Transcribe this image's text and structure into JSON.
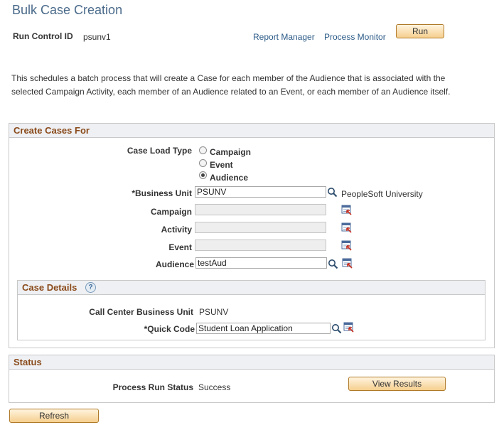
{
  "page": {
    "title": "Bulk Case Creation",
    "run_control_label": "Run Control ID",
    "run_control_value": "psunv1",
    "report_manager": "Report Manager",
    "process_monitor": "Process Monitor",
    "run_button": "Run",
    "description": "This schedules a batch process that will create a Case for each member of the Audience that is associated with the selected Campaign Activity, each member of an Audience related to an Event, or each member of an Audience itself."
  },
  "create_cases": {
    "header": "Create Cases For",
    "case_load_type_label": "Case Load Type",
    "options": [
      {
        "label": "Campaign",
        "selected": false
      },
      {
        "label": "Event",
        "selected": false
      },
      {
        "label": "Audience",
        "selected": true
      }
    ],
    "business_unit_label": "*Business Unit",
    "business_unit_value": "PSUNV",
    "business_unit_desc": "PeopleSoft University",
    "campaign_label": "Campaign",
    "campaign_value": "",
    "activity_label": "Activity",
    "activity_value": "",
    "event_label": "Event",
    "event_value": "",
    "audience_label": "Audience",
    "audience_value": "testAud"
  },
  "case_details": {
    "header": "Case Details",
    "help_icon": "?",
    "ccbu_label": "Call Center Business Unit",
    "ccbu_value": "PSUNV",
    "quick_code_label": "*Quick Code",
    "quick_code_value": "Student Loan Application"
  },
  "status": {
    "header": "Status",
    "process_run_status_label": "Process Run Status",
    "process_run_status_value": "Success",
    "view_results_button": "View Results"
  },
  "refresh_button": "Refresh"
}
